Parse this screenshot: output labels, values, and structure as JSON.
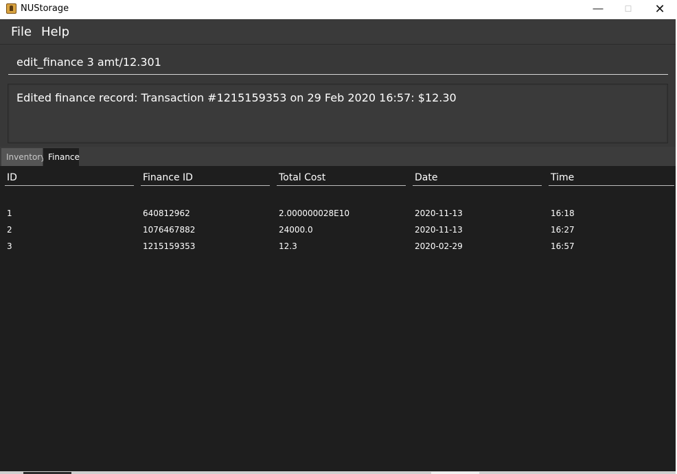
{
  "window": {
    "title": "NUStorage",
    "minimize_glyph": "—",
    "maximize_glyph": "☐",
    "close_glyph": "✕"
  },
  "menu": {
    "file_label": "File",
    "help_label": "Help"
  },
  "command": {
    "value": "edit_finance 3 amt/12.301"
  },
  "result": {
    "text": "Edited finance record: Transaction #1215159353 on 29 Feb 2020 16:57: $12.30"
  },
  "tabs": [
    {
      "label": "Inventory",
      "selected": false
    },
    {
      "label": "Finance",
      "selected": true
    }
  ],
  "table": {
    "headers": [
      "ID",
      "Finance ID",
      "Total Cost",
      "Date",
      "Time"
    ],
    "rows": [
      {
        "id": "1",
        "finance_id": "640812962",
        "total_cost": "2.000000028E10",
        "date": "2020-11-13",
        "time": "16:18"
      },
      {
        "id": "2",
        "finance_id": "1076467882",
        "total_cost": "24000.0",
        "date": "2020-11-13",
        "time": "16:27"
      },
      {
        "id": "3",
        "finance_id": "1215159353",
        "total_cost": "12.3",
        "date": "2020-02-29",
        "time": "16:57"
      }
    ]
  },
  "colors": {
    "background": "#1e1e1e",
    "panel": "#383838",
    "text": "#ffffff"
  }
}
